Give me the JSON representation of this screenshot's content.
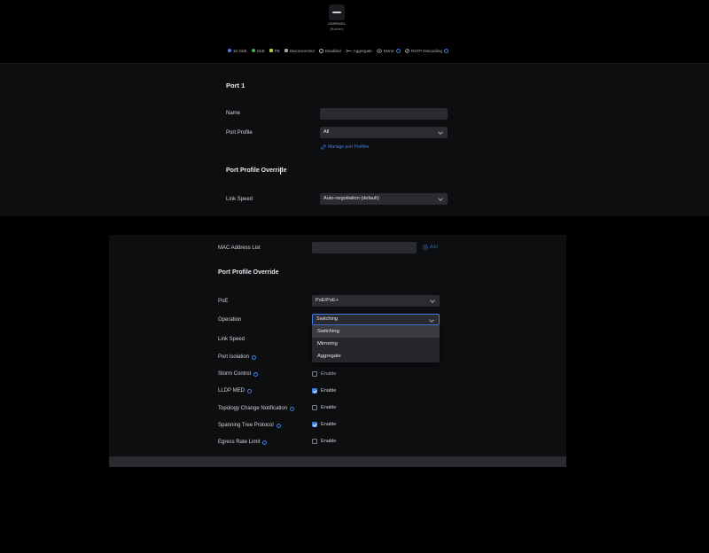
{
  "device": {
    "name": "US8P60DL",
    "subtitle": "(Builder)"
  },
  "legend": {
    "items": [
      {
        "label": "10 GbE",
        "color": "#3f7fe5",
        "shape": "dot"
      },
      {
        "label": "GbE",
        "color": "#4caf50",
        "shape": "dot"
      },
      {
        "label": "PE",
        "color": "#b5c94a",
        "shape": "square"
      },
      {
        "label": "Disconnected",
        "color": "#9aa0a8",
        "shape": "square"
      },
      {
        "label": "Disabled",
        "color": "#aeb2b9",
        "shape": "ring"
      },
      {
        "label": "Aggregate",
        "icon": "aggregate-icon"
      },
      {
        "label": "Mirror",
        "icon": "mirror-icon"
      },
      {
        "label": "RSTP Discarding",
        "icon": "rstp-icon"
      }
    ]
  },
  "port_panel": {
    "title": "Port 1",
    "name_label": "Name",
    "name_value": "",
    "profile_label": "Port Profile",
    "profile_value": "All",
    "manage_link": "Manage port Profiles",
    "override_title": "Port Profile Override",
    "link_speed_label": "Link Speed",
    "link_speed_value": "Auto-negotiation (default)"
  },
  "override_panel": {
    "mac_label": "MAC Address List",
    "mac_value": "",
    "add_label": "Add",
    "override_title": "Port Profile Override",
    "poe_label": "PoE",
    "poe_value": "PoE/PoE+",
    "operation_label": "Operation",
    "operation_value": "Switching",
    "operation_options": [
      "Switching",
      "Mirroring",
      "Aggregate"
    ],
    "link_speed_label": "Link Speed",
    "rows": [
      {
        "label": "Port Isolation",
        "info": true,
        "checkbox": false,
        "checked": false,
        "text": ""
      },
      {
        "label": "Storm Control",
        "info": true,
        "checkbox": true,
        "checked": false,
        "text": "Enable"
      },
      {
        "label": "LLDP MED",
        "info": true,
        "checkbox": true,
        "checked": true,
        "text": "Enable"
      },
      {
        "label": "Topology Change Notification",
        "info": true,
        "checkbox": true,
        "checked": false,
        "text": "Enable"
      },
      {
        "label": "Spanning Tree Protocol",
        "info": true,
        "checkbox": true,
        "checked": true,
        "text": "Enable"
      },
      {
        "label": "Egress Rate Limit",
        "info": true,
        "checkbox": true,
        "checked": false,
        "text": "Enable"
      }
    ]
  },
  "colors": {
    "accent": "#3f7fe5",
    "panel_bg": "#0d0e10",
    "field_bg": "#2a2c31"
  }
}
